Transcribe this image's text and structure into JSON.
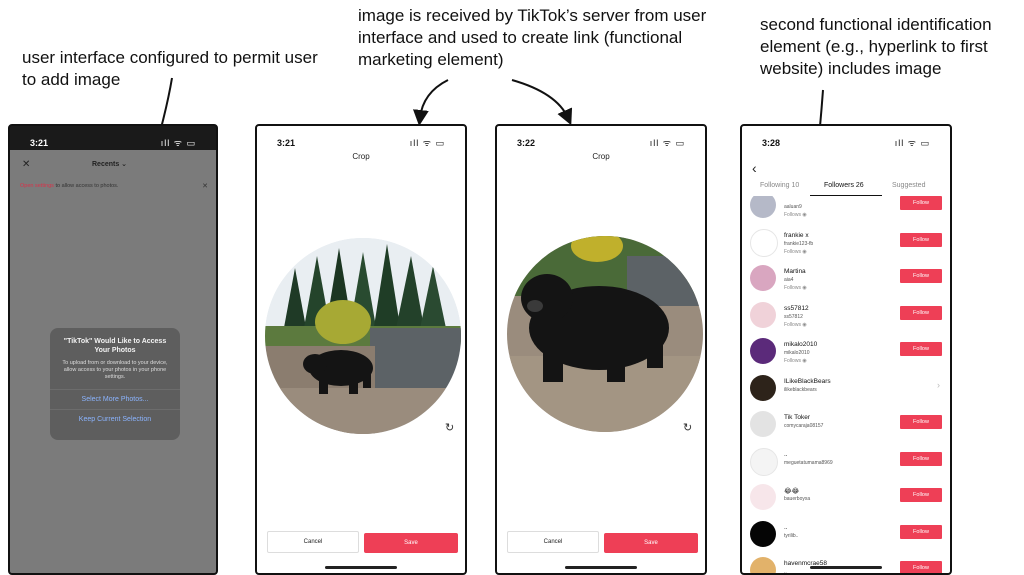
{
  "annotations": {
    "left": "user interface configured to permit user to add image",
    "middle": "image is received by TikTok’s server from user interface and used to create link (functional marketing element)",
    "right": "second functional identification element (e.g., hyperlink to first website) includes image"
  },
  "phone1": {
    "time": "3:21",
    "status_icons": "ıll ᯤ ▭",
    "close": "✕",
    "dropdown": "Recents ⌄",
    "banner_link": "Open settings",
    "banner_text": "to allow access to photos.",
    "banner_close": "✕",
    "dialog_title": "\"TikTok\" Would Like to Access Your Photos",
    "dialog_body": "To upload from or download to your device, allow access to your photos in your phone settings.",
    "option1": "Select More Photos...",
    "option2": "Keep Current Selection"
  },
  "phone2": {
    "time": "3:21",
    "status_icons": "ıll ᯤ ▭",
    "title": "Crop",
    "rotate": "↻",
    "cancel": "Cancel",
    "save": "Save"
  },
  "phone3": {
    "time": "3:22",
    "status_icons": "ıll ᯤ ▭",
    "title": "Crop",
    "rotate": "↻",
    "cancel": "Cancel",
    "save": "Save"
  },
  "phone4": {
    "time": "3:28",
    "status_icons": "ıll ᯤ ▭",
    "back": "‹",
    "tabs": [
      "Following 10",
      "Followers 26",
      "Suggested"
    ],
    "follow_label": "Follow",
    "followers": [
      {
        "name": "",
        "handle": "aaluan9",
        "label": "Follows ◉",
        "color": "#b5b9c8",
        "button": true
      },
      {
        "name": "frankie x",
        "handle": "frankie123-fb",
        "label": "Follows ◉",
        "color": "#ffffff",
        "button": true
      },
      {
        "name": "Martina",
        "handle": "aia4",
        "label": "Follows ◉",
        "color": "#d9a6c0",
        "button": true
      },
      {
        "name": "ss57812",
        "handle": "ss57812",
        "label": "Follows ◉",
        "color": "#f0d2d9",
        "button": true
      },
      {
        "name": "mikalo2010",
        "handle": "mikalo2010",
        "label": "Follows ◉",
        "color": "#5b2a7a",
        "button": true
      },
      {
        "name": "ILikeBlackBears",
        "handle": "ilikeblackbears",
        "label": "",
        "color": "#2d231a",
        "button": false
      },
      {
        "name": "Tik Toker",
        "handle": "comycaraja08157",
        "label": "",
        "color": "#e3e3e3",
        "button": true
      },
      {
        "name": "..",
        "handle": "meguetatumama8969",
        "label": "",
        "color": "#f4f4f4",
        "button": true
      },
      {
        "name": "😂😂",
        "handle": "bauerboyxa",
        "label": "",
        "color": "#f7e6ea",
        "button": true
      },
      {
        "name": "..",
        "handle": "tyrilib..",
        "label": "",
        "color": "#050505",
        "button": true
      },
      {
        "name": "havenmcrae58",
        "handle": "..",
        "label": "",
        "color": "#e2b26a",
        "button": true
      }
    ]
  },
  "colors": {
    "accent": "#ee3f56"
  }
}
